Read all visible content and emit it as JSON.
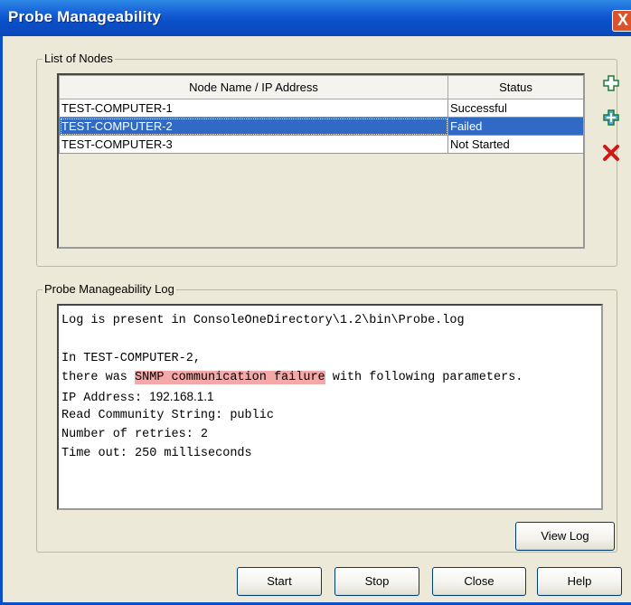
{
  "window": {
    "title": "Probe Manageability",
    "close_glyph": "X"
  },
  "nodes": {
    "legend": "List of Nodes",
    "columns": [
      "Node Name / IP Address",
      "Status"
    ],
    "rows": [
      {
        "name": "TEST-COMPUTER-1",
        "status": "Successful"
      },
      {
        "name": "TEST-COMPUTER-2",
        "status": "Failed"
      },
      {
        "name": "TEST-COMPUTER-3",
        "status": "Not Started"
      }
    ],
    "selected_row": 1,
    "side_icons": [
      "add-node-icon",
      "edit-node-icon",
      "delete-node-icon"
    ]
  },
  "log": {
    "legend": "Probe Manageability Log",
    "line1": "Log is present in ConsoleOneDirectory\\1.2\\bin\\Probe.log",
    "line2": "In TEST-COMPUTER-2,",
    "line3_pre": "there was ",
    "line3_hl": "SNMP communication failure",
    "line3_post": " with following parameters.",
    "ip_label": "IP Address: ",
    "ip_value": "192.168.1.1",
    "community": "Read Community String: public",
    "retries": "Number of retries: 2",
    "timeout": "Time out: 250 milliseconds",
    "view_log_label": "View Log",
    "highlight_color": "#f4a8a8"
  },
  "buttons": {
    "start": "Start",
    "stop": "Stop",
    "close": "Close",
    "help": "Help"
  },
  "colors": {
    "titlebar": "#0a4fc9",
    "selection": "#316ac5",
    "dialog_bg": "#ece9d8"
  }
}
